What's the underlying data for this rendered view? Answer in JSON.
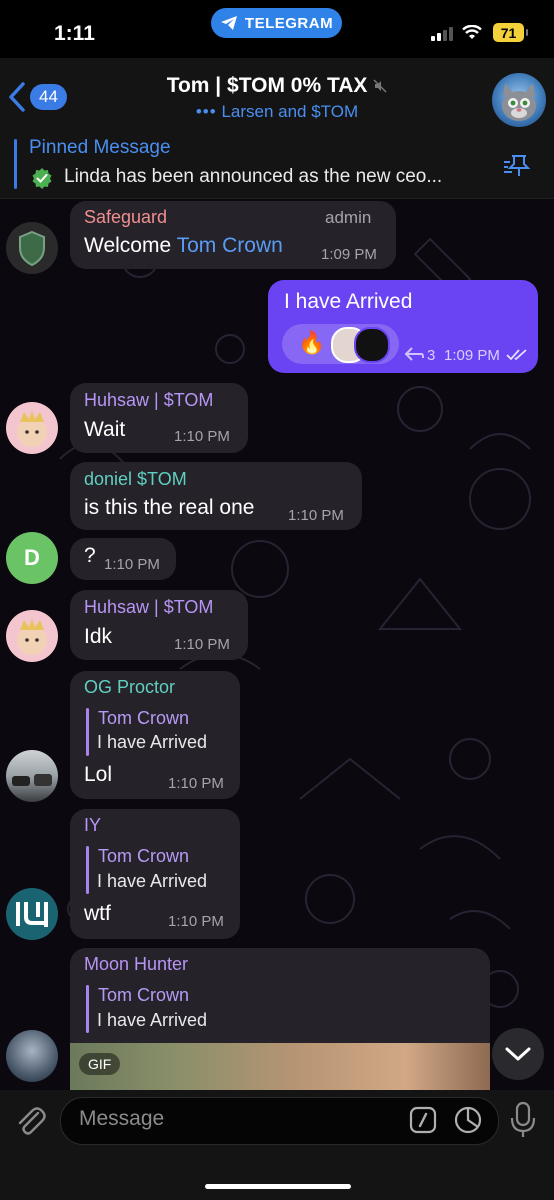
{
  "status": {
    "time": "1:11",
    "app_pill": "TELEGRAM",
    "battery": "71"
  },
  "header": {
    "back_count": "44",
    "title": "Tom | $TOM 0% TAX",
    "subtitle": "Larsen and $TOM"
  },
  "pinned": {
    "title": "Pinned Message",
    "text": "Linda has been announced as the new ceo..."
  },
  "messages": [
    {
      "sender": "Safeguard",
      "badge": "admin",
      "text_prefix": "Welcome ",
      "mention": "Tom Crown",
      "time": "1:09 PM"
    },
    {
      "text": "I have Arrived",
      "reply_count": "3",
      "time": "1:09 PM",
      "outgoing": true
    },
    {
      "sender": "Huhsaw | $TOM",
      "text": "Wait",
      "time": "1:10 PM"
    },
    {
      "sender": "doniel $TOM",
      "text": "is this the real one",
      "time": "1:10 PM"
    },
    {
      "text": "?",
      "time": "1:10 PM",
      "avatar_letter": "D"
    },
    {
      "sender": "Huhsaw | $TOM",
      "text": "Idk",
      "time": "1:10 PM"
    },
    {
      "sender": "OG Proctor",
      "quote_name": "Tom Crown",
      "quote_text": "I have Arrived",
      "text": "Lol",
      "time": "1:10 PM"
    },
    {
      "sender": "IY",
      "quote_name": "Tom Crown",
      "quote_text": "I have Arrived",
      "text": "wtf",
      "time": "1:10 PM"
    },
    {
      "sender": "Moon Hunter",
      "quote_name": "Tom Crown",
      "quote_text": "I have Arrived",
      "media_label": "GIF"
    }
  ],
  "input": {
    "placeholder": "Message"
  },
  "colors": {
    "accent": "#3a7be5",
    "outgoing_bubble": "#6a43f2",
    "incoming_bubble": "#252229"
  }
}
